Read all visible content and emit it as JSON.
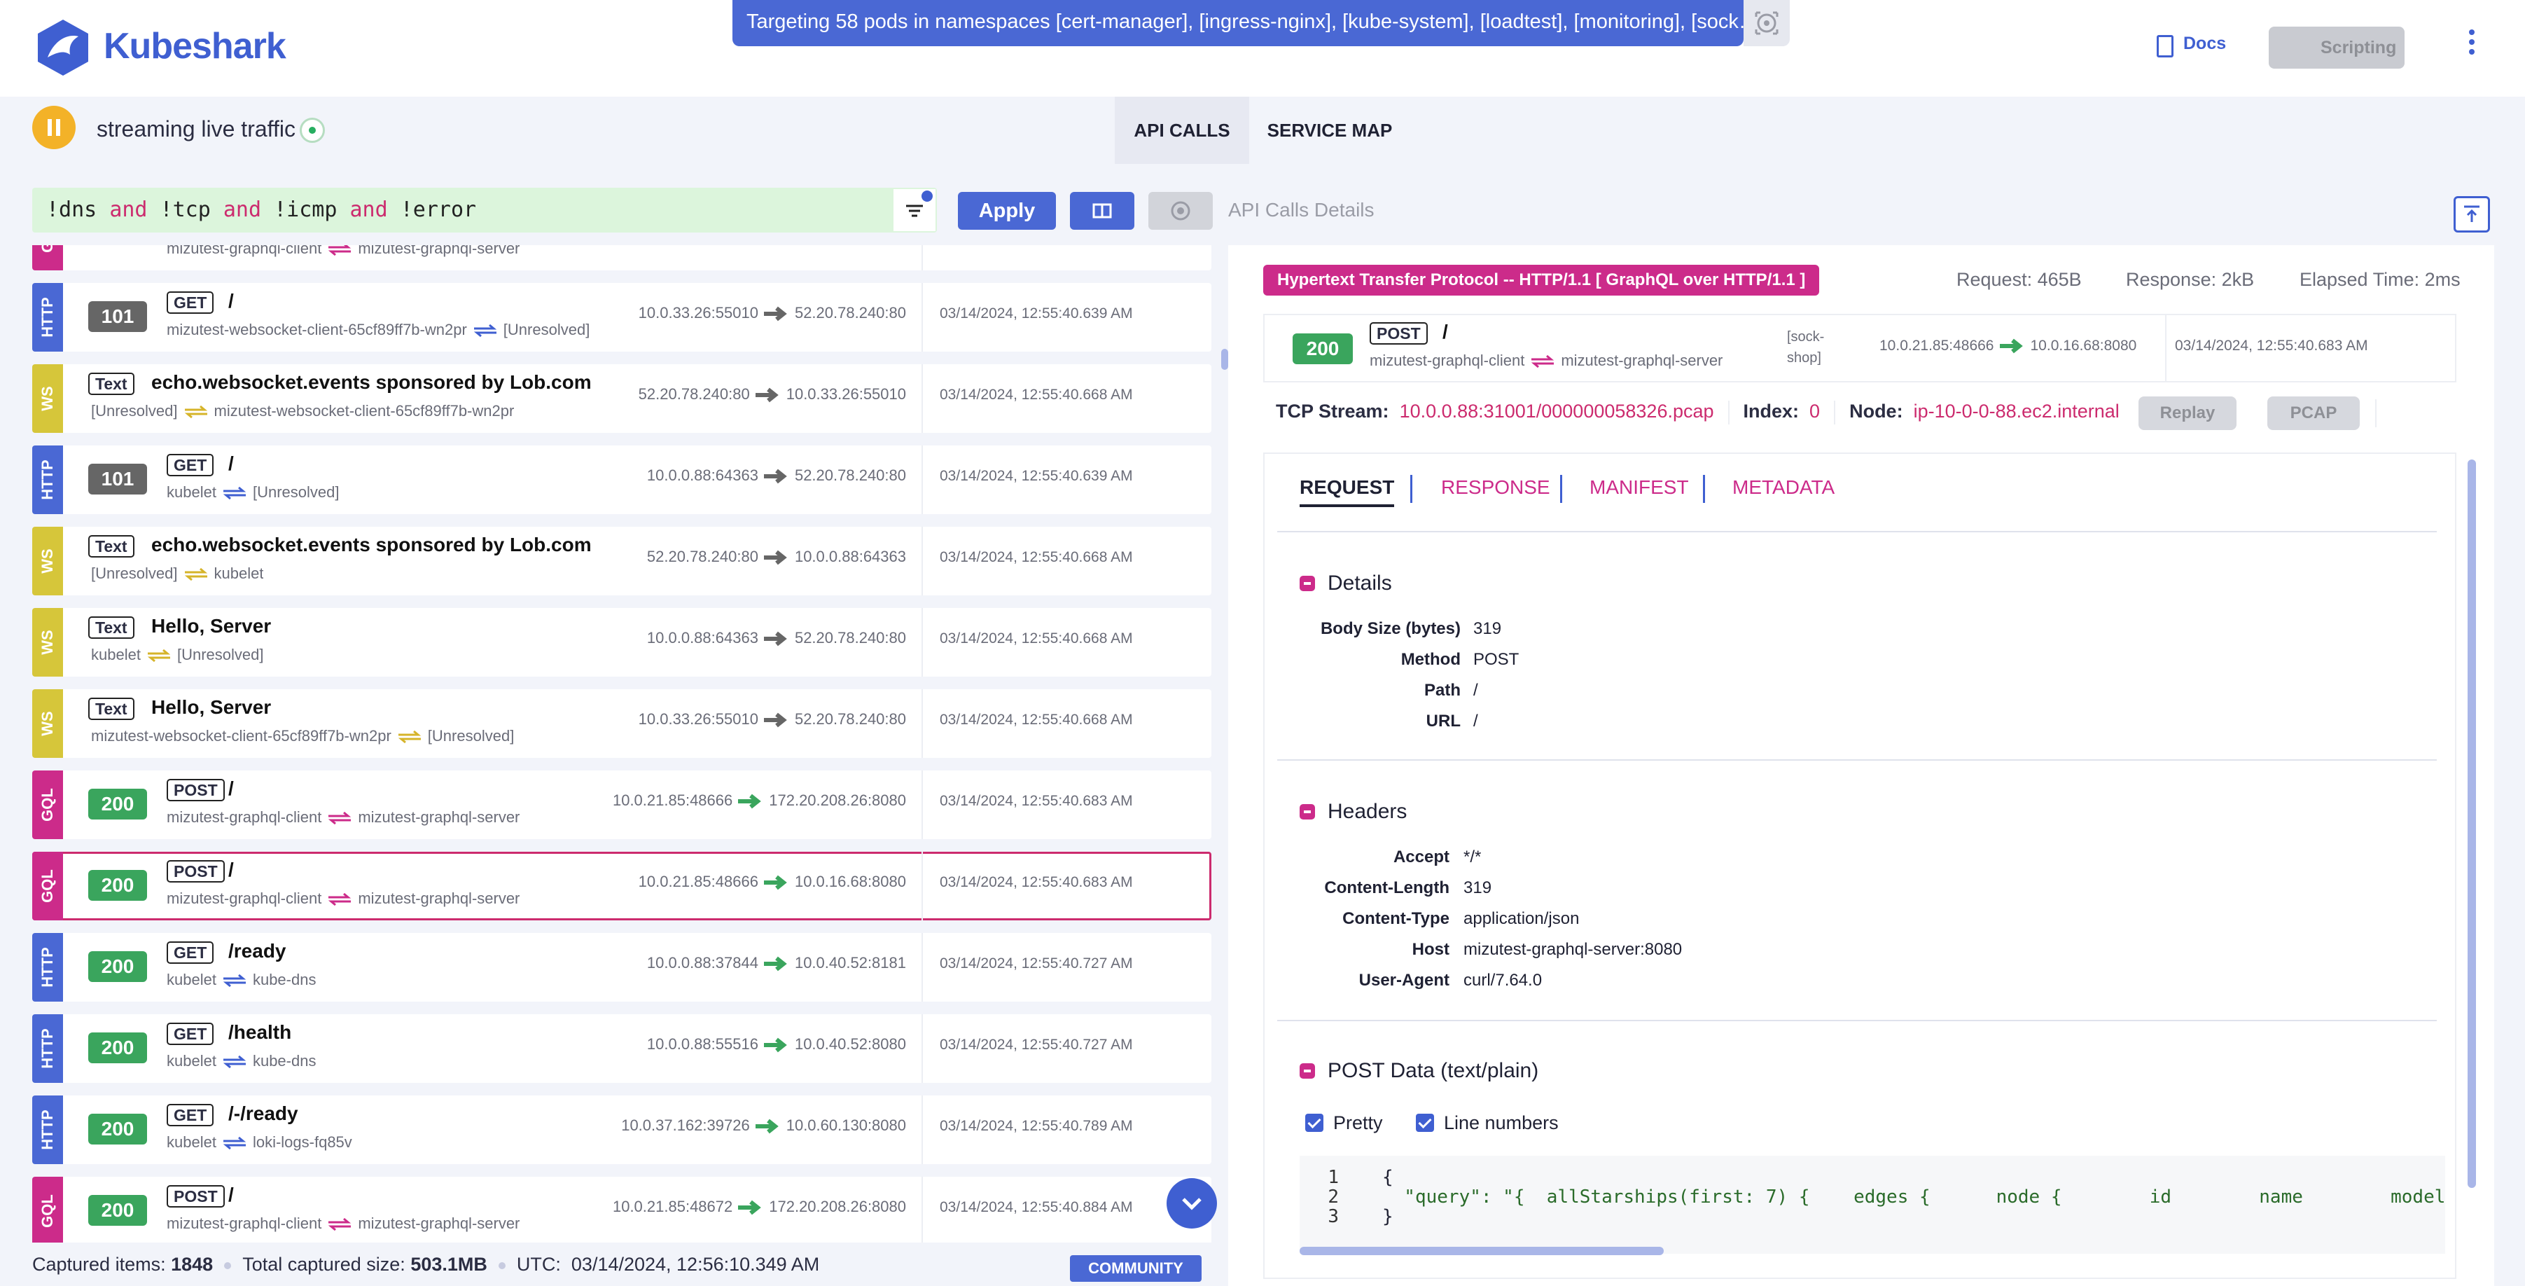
{
  "header": {
    "brand": "Kubeshark",
    "banner": "Targeting 58 pods in namespaces [cert-manager], [ingress-nginx], [kube-system], [loadtest], [monitoring], [sock…",
    "docs_label": "Docs",
    "scripting_label": "Scripting"
  },
  "stream": {
    "status_text": "streaming live traffic",
    "tabs": [
      "API CALLS",
      "SERVICE MAP"
    ]
  },
  "filter": {
    "query_parts": [
      "!dns ",
      "and",
      " !tcp ",
      "and",
      " !icmp ",
      "and",
      " !error"
    ],
    "apply_label": "Apply"
  },
  "details_title": "API Calls Details",
  "rows": [
    {
      "proto": "GQL",
      "status": "",
      "method": "",
      "path": "",
      "src": "mizutest-graphql-client",
      "dst": "mizutest-graphql-server",
      "src_ip": "",
      "dst_ip": "",
      "time": ""
    },
    {
      "proto": "HTTP",
      "status": "101",
      "method": "GET",
      "path": "/",
      "src": "mizutest-websocket-client-65cf89ff7b-wn2pr",
      "dst": "[Unresolved]",
      "src_ip": "10.0.33.26:55010",
      "dst_ip": "52.20.78.240:80",
      "time": "03/14/2024, 12:55:40.639 AM"
    },
    {
      "proto": "WS",
      "status": "",
      "method": "Text",
      "path": "echo.websocket.events sponsored by Lob.com",
      "src": "[Unresolved]",
      "dst": "mizutest-websocket-client-65cf89ff7b-wn2pr",
      "src_ip": "52.20.78.240:80",
      "dst_ip": "10.0.33.26:55010",
      "time": "03/14/2024, 12:55:40.668 AM"
    },
    {
      "proto": "HTTP",
      "status": "101",
      "method": "GET",
      "path": "/",
      "src": "kubelet",
      "dst": "[Unresolved]",
      "src_ip": "10.0.0.88:64363",
      "dst_ip": "52.20.78.240:80",
      "time": "03/14/2024, 12:55:40.639 AM"
    },
    {
      "proto": "WS",
      "status": "",
      "method": "Text",
      "path": "echo.websocket.events sponsored by Lob.com",
      "src": "[Unresolved]",
      "dst": "kubelet",
      "src_ip": "52.20.78.240:80",
      "dst_ip": "10.0.0.88:64363",
      "time": "03/14/2024, 12:55:40.668 AM"
    },
    {
      "proto": "WS",
      "status": "",
      "method": "Text",
      "path": "Hello, Server",
      "src": "kubelet",
      "dst": "[Unresolved]",
      "src_ip": "10.0.0.88:64363",
      "dst_ip": "52.20.78.240:80",
      "time": "03/14/2024, 12:55:40.668 AM"
    },
    {
      "proto": "WS",
      "status": "",
      "method": "Text",
      "path": "Hello, Server",
      "src": "mizutest-websocket-client-65cf89ff7b-wn2pr",
      "dst": "[Unresolved]",
      "src_ip": "10.0.33.26:55010",
      "dst_ip": "52.20.78.240:80",
      "time": "03/14/2024, 12:55:40.668 AM"
    },
    {
      "proto": "GQL",
      "status": "200",
      "method": "POST",
      "path": "/",
      "src": "mizutest-graphql-client",
      "dst": "mizutest-graphql-server",
      "src_ip": "10.0.21.85:48666",
      "dst_ip": "172.20.208.26:8080",
      "time": "03/14/2024, 12:55:40.683 AM"
    },
    {
      "proto": "GQL",
      "status": "200",
      "method": "POST",
      "path": "/",
      "src": "mizutest-graphql-client",
      "dst": "mizutest-graphql-server",
      "src_ip": "10.0.21.85:48666",
      "dst_ip": "10.0.16.68:8080",
      "time": "03/14/2024, 12:55:40.683 AM"
    },
    {
      "proto": "HTTP",
      "status": "200",
      "method": "GET",
      "path": "/ready",
      "src": "kubelet",
      "dst": "kube-dns",
      "src_ip": "10.0.0.88:37844",
      "dst_ip": "10.0.40.52:8181",
      "time": "03/14/2024, 12:55:40.727 AM"
    },
    {
      "proto": "HTTP",
      "status": "200",
      "method": "GET",
      "path": "/health",
      "src": "kubelet",
      "dst": "kube-dns",
      "src_ip": "10.0.0.88:55516",
      "dst_ip": "10.0.40.52:8080",
      "time": "03/14/2024, 12:55:40.727 AM"
    },
    {
      "proto": "HTTP",
      "status": "200",
      "method": "GET",
      "path": "/-/ready",
      "src": "kubelet",
      "dst": "loki-logs-fq85v",
      "src_ip": "10.0.37.162:39726",
      "dst_ip": "10.0.60.130:8080",
      "time": "03/14/2024, 12:55:40.789 AM"
    },
    {
      "proto": "GQL",
      "status": "200",
      "method": "POST",
      "path": "/",
      "src": "mizutest-graphql-client",
      "dst": "mizutest-graphql-server",
      "src_ip": "10.0.21.85:48672",
      "dst_ip": "172.20.208.26:8080",
      "time": "03/14/2024, 12:55:40.884 AM"
    }
  ],
  "footer": {
    "captured_label": "Captured items:",
    "captured_value": "1848",
    "size_label": "Total captured size:",
    "size_value": "503.1MB",
    "utc_label": "UTC:",
    "utc_value": "03/14/2024, 12:56:10.349 AM",
    "edition": "COMMUNITY"
  },
  "detail": {
    "protocol": "Hypertext Transfer Protocol -- HTTP/1.1 [ GraphQL over HTTP/1.1 ]",
    "request_size": "Request: 465B",
    "response_size": "Response: 2kB",
    "elapsed": "Elapsed Time: 2ms",
    "status": "200",
    "method": "POST",
    "path": "/",
    "src": "mizutest-graphql-client",
    "dst": "mizutest-graphql-server",
    "namespace": "[sock-shop]",
    "src_ip": "10.0.21.85:48666",
    "dst_ip": "10.0.16.68:8080",
    "time": "03/14/2024, 12:55:40.683 AM",
    "tcp_label": "TCP Stream:",
    "tcp_value": "10.0.0.88:31001/000000058326.pcap",
    "index_label": "Index:",
    "index_value": "0",
    "node_label": "Node:",
    "node_value": "ip-10-0-0-88.ec2.internal",
    "replay_label": "Replay",
    "pcap_label": "PCAP",
    "tabs": [
      "REQUEST",
      "RESPONSE",
      "MANIFEST",
      "METADATA"
    ],
    "details_section": "Details",
    "details_rows": [
      {
        "k": "Body Size (bytes)",
        "v": "319"
      },
      {
        "k": "Method",
        "v": "POST"
      },
      {
        "k": "Path",
        "v": "/"
      },
      {
        "k": "URL",
        "v": "/"
      }
    ],
    "headers_section": "Headers",
    "headers_rows": [
      {
        "k": "Accept",
        "v": "*/*"
      },
      {
        "k": "Content-Length",
        "v": "319"
      },
      {
        "k": "Content-Type",
        "v": "application/json"
      },
      {
        "k": "Host",
        "v": "mizutest-graphql-server:8080"
      },
      {
        "k": "User-Agent",
        "v": "curl/7.64.0"
      }
    ],
    "post_section": "POST Data (text/plain)",
    "pretty_label": "Pretty",
    "linenum_label": "Line numbers",
    "code_lines": [
      {
        "n": "1",
        "t": "{"
      },
      {
        "n": "2",
        "t": "  \"query\": \"{  allStarships(first: 7) {    edges {      node {        id        name        model"
      },
      {
        "n": "3",
        "t": "}"
      }
    ]
  }
}
